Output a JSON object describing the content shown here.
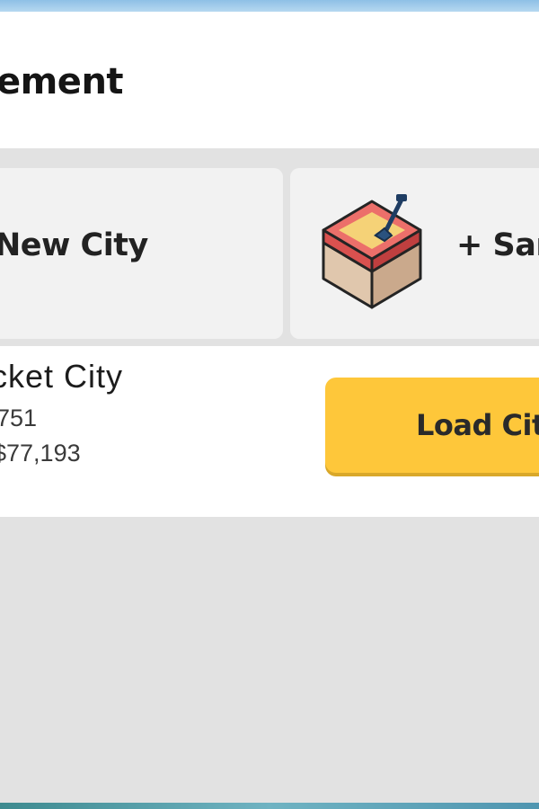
{
  "header": {
    "title": "ement"
  },
  "options": {
    "new_city_label": "New City",
    "sandbox_label": "+ San",
    "sandbox_icon": "sandbox-shovel-icon"
  },
  "saved_city": {
    "name": "cket City",
    "population": "751",
    "money": "$77,193",
    "load_label": "Load City"
  },
  "colors": {
    "load_button": "#fec73a",
    "card_bg": "#f2f2f2",
    "panel_bg": "#ffffff",
    "background": "#e2e2e2",
    "sandbox_rim": "#dd5f5b",
    "sand": "#f5d277"
  }
}
